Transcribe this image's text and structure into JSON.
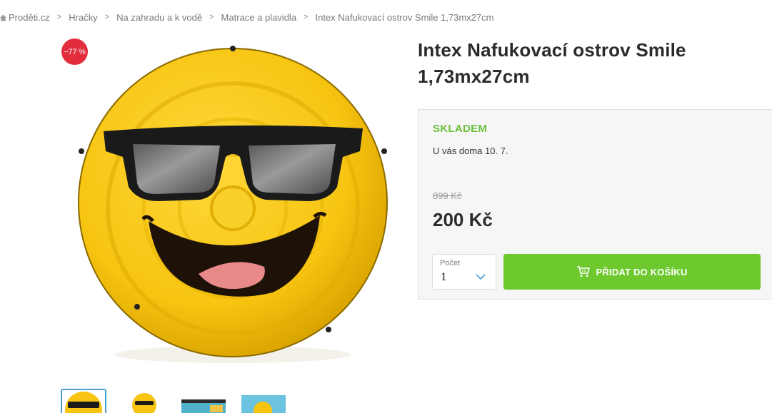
{
  "breadcrumb": {
    "items": [
      "Proděti.cz",
      "Hračky",
      "Na zahradu a k vodě",
      "Matrace a plavidla",
      "Intex Nafukovací ostrov Smile 1,73mx27cm"
    ],
    "separator": ">"
  },
  "gallery": {
    "discount_badge": "−77 %",
    "main_image": "smiley-sunglasses-float",
    "thumbnails": [
      "smiley-sunglasses-float",
      "smiley-float-side",
      "pool-photo",
      "pool-float-photo"
    ]
  },
  "product": {
    "title": "Intex Nafukovací ostrov Smile 1,73mx27cm"
  },
  "buybox": {
    "stock_status": "SKLADEM",
    "delivery": "U vás doma 10. 7.",
    "old_price": "899 Kč",
    "price": "200 Kč",
    "quantity": {
      "label": "Počet",
      "value": "1"
    },
    "add_to_cart_label": "PŘIDAT DO KOŠÍKU"
  },
  "colors": {
    "stock_green": "#6bbf3b",
    "button_green": "#6ec92f",
    "badge_red": "#e22d3c",
    "active_thumb_border": "#4a9fd8"
  }
}
